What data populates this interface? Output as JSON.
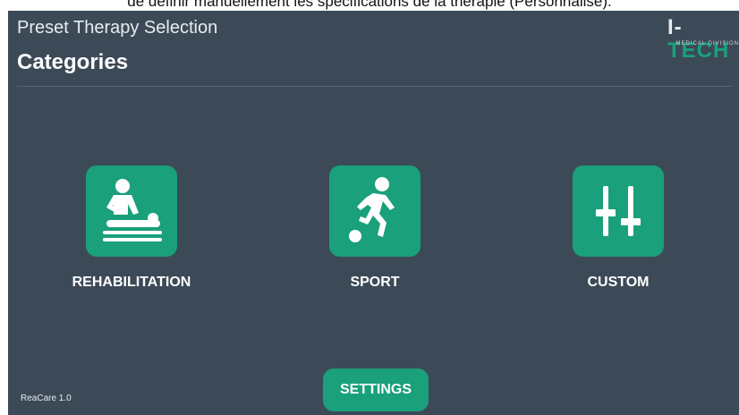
{
  "caption": "de définir manuellement les spécifications de la thérapie (Personnalisé).",
  "header": {
    "title": "Preset Therapy Selection",
    "subtitle": "Categories"
  },
  "logo": {
    "mark_part1": "I-",
    "mark_part2": "TECH",
    "tagline": "MEDICAL DIVISION",
    "colors": {
      "primary": "#1aa07a",
      "secondary": "#e8ecef"
    }
  },
  "categories": [
    {
      "label": "REHABILITATION",
      "icon": "massage-therapy-icon"
    },
    {
      "label": "SPORT",
      "icon": "soccer-player-icon"
    },
    {
      "label": "CUSTOM",
      "icon": "sliders-icon"
    }
  ],
  "settings": {
    "label": "SETTINGS"
  },
  "footer": {
    "version": "ReaCare 1.0"
  },
  "colors": {
    "background": "#3c4a58",
    "accent": "#1aa07a",
    "text": "#ffffff"
  }
}
